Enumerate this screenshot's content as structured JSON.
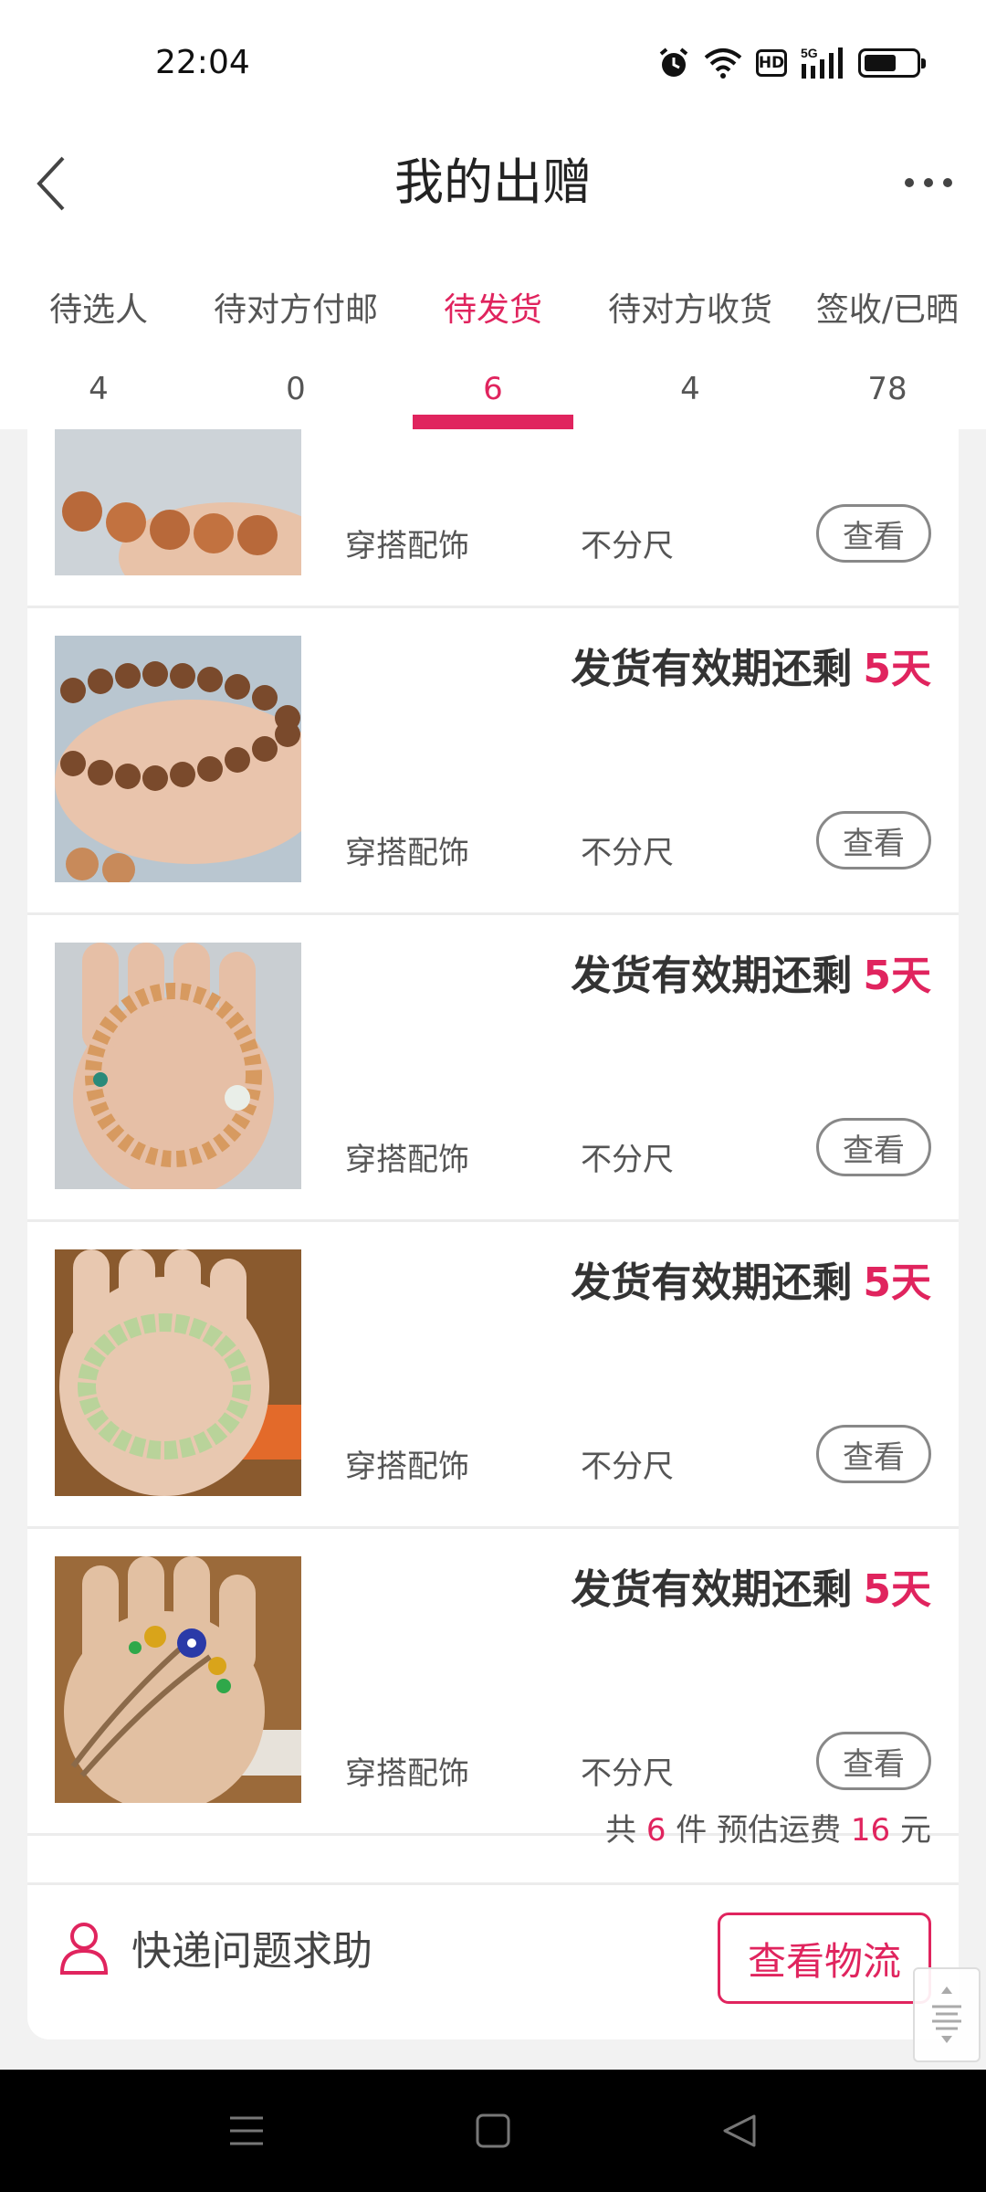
{
  "status_bar": {
    "time": "22:04",
    "icons": [
      "alarm-icon",
      "wifi-icon",
      "hd-badge",
      "signal-5g-icon",
      "battery-icon"
    ],
    "hd_label": "HD",
    "network_label": "5G",
    "battery_level": 0.6
  },
  "header": {
    "title": "我的出赠",
    "back_icon": "chevron-left-icon",
    "more_icon": "more-dots-icon"
  },
  "tabs": [
    {
      "label": "待选人",
      "count": "4",
      "active": false
    },
    {
      "label": "待对方付邮",
      "count": "0",
      "active": false
    },
    {
      "label": "待发货",
      "count": "6",
      "active": true
    },
    {
      "label": "待对方收货",
      "count": "4",
      "active": false
    },
    {
      "label": "签收/已晒",
      "count": "78",
      "active": false
    }
  ],
  "items": [
    {
      "deadline_label": "",
      "days": "",
      "category": "穿搭配饰",
      "size": "不分尺",
      "view_label": "查看",
      "thumb": "rudraksha-beads-partial"
    },
    {
      "deadline_label": "发货有效期还剩",
      "days": "5天",
      "category": "穿搭配饰",
      "size": "不分尺",
      "view_label": "查看",
      "thumb": "rudraksha-bead-bracelet"
    },
    {
      "deadline_label": "发货有效期还剩",
      "days": "5天",
      "category": "穿搭配饰",
      "size": "不分尺",
      "view_label": "查看",
      "thumb": "wooden-bead-bracelet"
    },
    {
      "deadline_label": "发货有效期还剩",
      "days": "5天",
      "category": "穿搭配饰",
      "size": "不分尺",
      "view_label": "查看",
      "thumb": "green-crystal-bracelet"
    },
    {
      "deadline_label": "发货有效期还剩",
      "days": "5天",
      "category": "穿搭配饰",
      "size": "不分尺",
      "view_label": "查看",
      "thumb": "braided-cord-bracelet"
    }
  ],
  "summary": {
    "prefix": "共",
    "count": "6",
    "middle": "件 预估运费",
    "fee": "16",
    "suffix": "元"
  },
  "help": {
    "label": "快递问题求助",
    "icon": "person-icon"
  },
  "logistics_button": "查看物流",
  "colors": {
    "accent": "#e0245e",
    "background": "#f2f2f2"
  },
  "navbar": {
    "icons": [
      "menu-icon",
      "home-square-icon",
      "back-triangle-icon"
    ]
  }
}
